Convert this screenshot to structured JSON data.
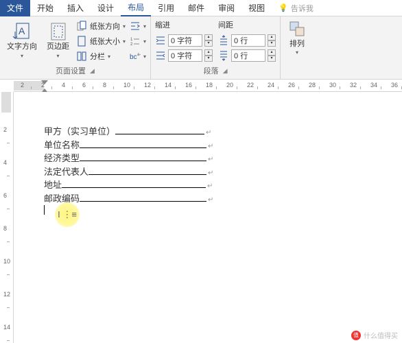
{
  "tabs": {
    "file": "文件",
    "home": "开始",
    "insert": "插入",
    "design": "设计",
    "layout": "布局",
    "references": "引用",
    "mailings": "邮件",
    "review": "审阅",
    "view": "视图",
    "tellme": "告诉我"
  },
  "ribbon": {
    "text_direction": "文字方向",
    "margins": "页边距",
    "orientation": "纸张方向",
    "size": "纸张大小",
    "columns": "分栏",
    "page_setup": "页面设置",
    "indent_header": "缩进",
    "spacing_header": "间距",
    "indent_left": "0 字符",
    "indent_right": "0 字符",
    "spacing_before": "0 行",
    "spacing_after": "0 行",
    "paragraph": "段落",
    "arrange": "排列"
  },
  "ruler": {
    "h": [
      "2",
      "2",
      "4",
      "6",
      "8",
      "10",
      "12",
      "14",
      "16",
      "18",
      "20",
      "22",
      "24",
      "26",
      "28",
      "30",
      "32",
      "34",
      "36"
    ],
    "v": [
      "2",
      "4",
      "6",
      "8",
      "10",
      "12",
      "14"
    ]
  },
  "doc": {
    "line1_label": "甲方（实习单位）",
    "line2_label": "单位名称",
    "line3_label": "经济类型",
    "line4_label": "法定代表人",
    "line5_label": "地址",
    "line6_label": "邮政编码"
  },
  "watermark": "什么值得买"
}
